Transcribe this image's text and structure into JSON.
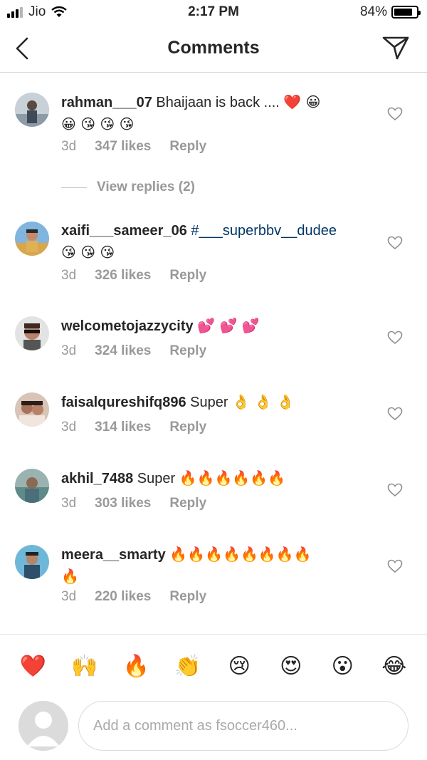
{
  "status_bar": {
    "carrier": "Jio",
    "time": "2:17 PM",
    "battery": "84%",
    "battery_level": 0.84
  },
  "nav": {
    "title": "Comments",
    "back_icon": "chevron-left-icon",
    "share_icon": "paper-plane-icon"
  },
  "comments": [
    {
      "username": "rahman___07",
      "text": " Bhaijaan is back ....",
      "emojis_inline": "❤️ 😀",
      "emojis_line2": "😀 😘 😘 😘",
      "time": "3d",
      "likes": "347 likes",
      "reply": "Reply"
    },
    {
      "username": "xaifi___sameer_06",
      "text": " ",
      "hashtag": "#___superbbv__dudee",
      "emojis_line2": "😘 😘 😘",
      "time": "3d",
      "likes": "326 likes",
      "reply": "Reply"
    },
    {
      "username": "welcometojazzycity",
      "text": " ",
      "emojis_inline": "💕 💕 💕",
      "time": "3d",
      "likes": "324 likes",
      "reply": "Reply"
    },
    {
      "username": "faisalqureshifq896",
      "text": " Super ",
      "emojis_inline": "👌 👌 👌",
      "time": "3d",
      "likes": "314 likes",
      "reply": "Reply"
    },
    {
      "username": "akhil_7488",
      "text": " Super ",
      "emojis_inline": "🔥🔥🔥🔥🔥🔥",
      "time": "3d",
      "likes": "303 likes",
      "reply": "Reply"
    },
    {
      "username": "meera__smarty",
      "text": " ",
      "emojis_inline": "🔥🔥🔥🔥🔥🔥🔥🔥",
      "emojis_line2": "🔥",
      "time": "3d",
      "likes": "220 likes",
      "reply": "Reply"
    }
  ],
  "view_replies": "View replies (2)",
  "reactions": [
    "❤️",
    "🙌",
    "🔥",
    "👏",
    "😢",
    "😍",
    "😮",
    "😂"
  ],
  "composer": {
    "placeholder": "Add a comment as fsoccer460..."
  },
  "colors": {
    "heart": "#e8173b",
    "link": "#003569",
    "secondary_text": "#999999"
  }
}
